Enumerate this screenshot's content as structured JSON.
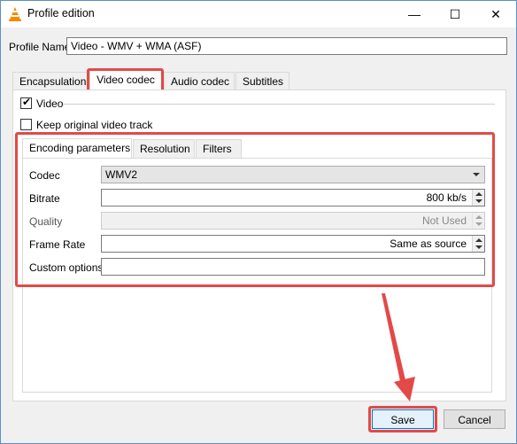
{
  "window": {
    "title": "Profile edition",
    "minimize_icon": "—",
    "maximize_icon": "☐",
    "close_icon": "✕"
  },
  "profile": {
    "label": "Profile Name",
    "value": "Video - WMV + WMA (ASF)"
  },
  "tabs": [
    "Encapsulation",
    "Video codec",
    "Audio codec",
    "Subtitles"
  ],
  "video": {
    "checkbox_label": "Video",
    "keep_original_label": "Keep original video track"
  },
  "subtabs": [
    "Encoding parameters",
    "Resolution",
    "Filters"
  ],
  "encoding": {
    "codec_label": "Codec",
    "codec_value": "WMV2",
    "bitrate_label": "Bitrate",
    "bitrate_value": "800 kb/s",
    "quality_label": "Quality",
    "quality_value": "Not Used",
    "framerate_label": "Frame Rate",
    "framerate_value": "Same as source",
    "custom_label": "Custom options",
    "custom_value": ""
  },
  "buttons": {
    "save": "Save",
    "cancel": "Cancel"
  },
  "colors": {
    "highlight": "#e24a47",
    "window_border": "#5b8fc9"
  }
}
